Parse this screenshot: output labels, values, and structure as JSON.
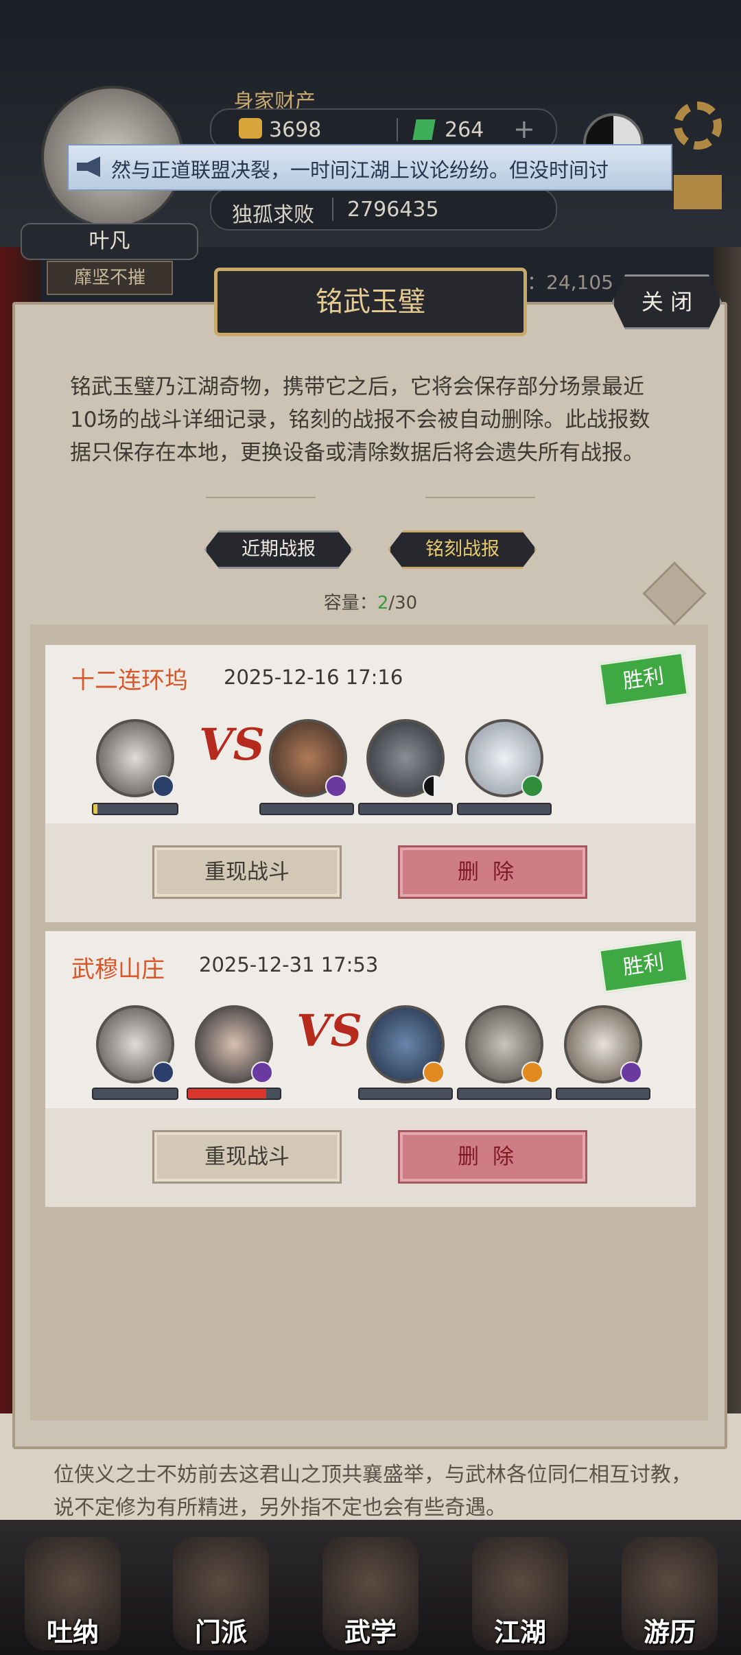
{
  "header": {
    "wealth_label": "身家财产",
    "gold": "3698",
    "jade": "264",
    "plus": "+",
    "rank_name": "独孤求败",
    "rank_value": "2796435",
    "player_name": "叶凡",
    "player_title": "靡坚不摧",
    "right_stat": "性：24,105"
  },
  "marquee": {
    "text": "然与正道联盟决裂，一时间江湖上议论纷纷。但没时间讨"
  },
  "dialog": {
    "title": "铭武玉璧",
    "close_label": "关 闭",
    "description": "铭武玉璧乃江湖奇物，携带它之后，它将会保存部分场景最近10场的战斗详细记录，铭刻的战报不会被自动删除。此战报数据只保存在本地，更换设备或清除数据后将会遗失所有战报。",
    "tabs": [
      {
        "label": "近期战报",
        "active": false
      },
      {
        "label": "铭刻战报",
        "active": true
      }
    ],
    "capacity_label": "容量：",
    "capacity_used": "2",
    "capacity_total": "/30"
  },
  "battles": [
    {
      "location": "十二连环坞",
      "time": "2025-12-16 17:16",
      "result": "胜利",
      "vs_label": "VS",
      "allies": [
        {
          "hp": 0.05,
          "badge": "male-symbol"
        }
      ],
      "enemies": [
        {
          "hp": 0,
          "badge": "purple-sword"
        },
        {
          "hp": 0,
          "badge": "taiji"
        },
        {
          "hp": 0,
          "badge": "green-leaf"
        }
      ],
      "replay_label": "重现战斗",
      "delete_label": "删除"
    },
    {
      "location": "武穆山庄",
      "time": "2025-12-31 17:53",
      "result": "胜利",
      "vs_label": "VS",
      "allies": [
        {
          "hp": 0,
          "badge": "male-symbol"
        },
        {
          "hp": 0.85,
          "badge": "purple-sword"
        }
      ],
      "enemies": [
        {
          "hp": 0,
          "badge": "orange-flame"
        },
        {
          "hp": 0,
          "badge": "orange-flame"
        },
        {
          "hp": 0,
          "badge": "purple-sword"
        }
      ],
      "replay_label": "重现战斗",
      "delete_label": "删除"
    }
  ],
  "background_text": "位侠义之士不妨前去这君山之顶共襄盛举，与武林各位同仁相互讨教，说不定修为有所精进，另外指不定也会有些奇遇。",
  "bottom_nav": [
    {
      "label": "吐纳"
    },
    {
      "label": "门派"
    },
    {
      "label": "武学"
    },
    {
      "label": "江湖"
    },
    {
      "label": "游历"
    }
  ],
  "colors": {
    "accent_gold": "#c8a96a",
    "location_orange": "#d7562a",
    "win_green": "#3fa843",
    "delete_red": "#cf7d85",
    "hp_red": "#d9352b"
  }
}
